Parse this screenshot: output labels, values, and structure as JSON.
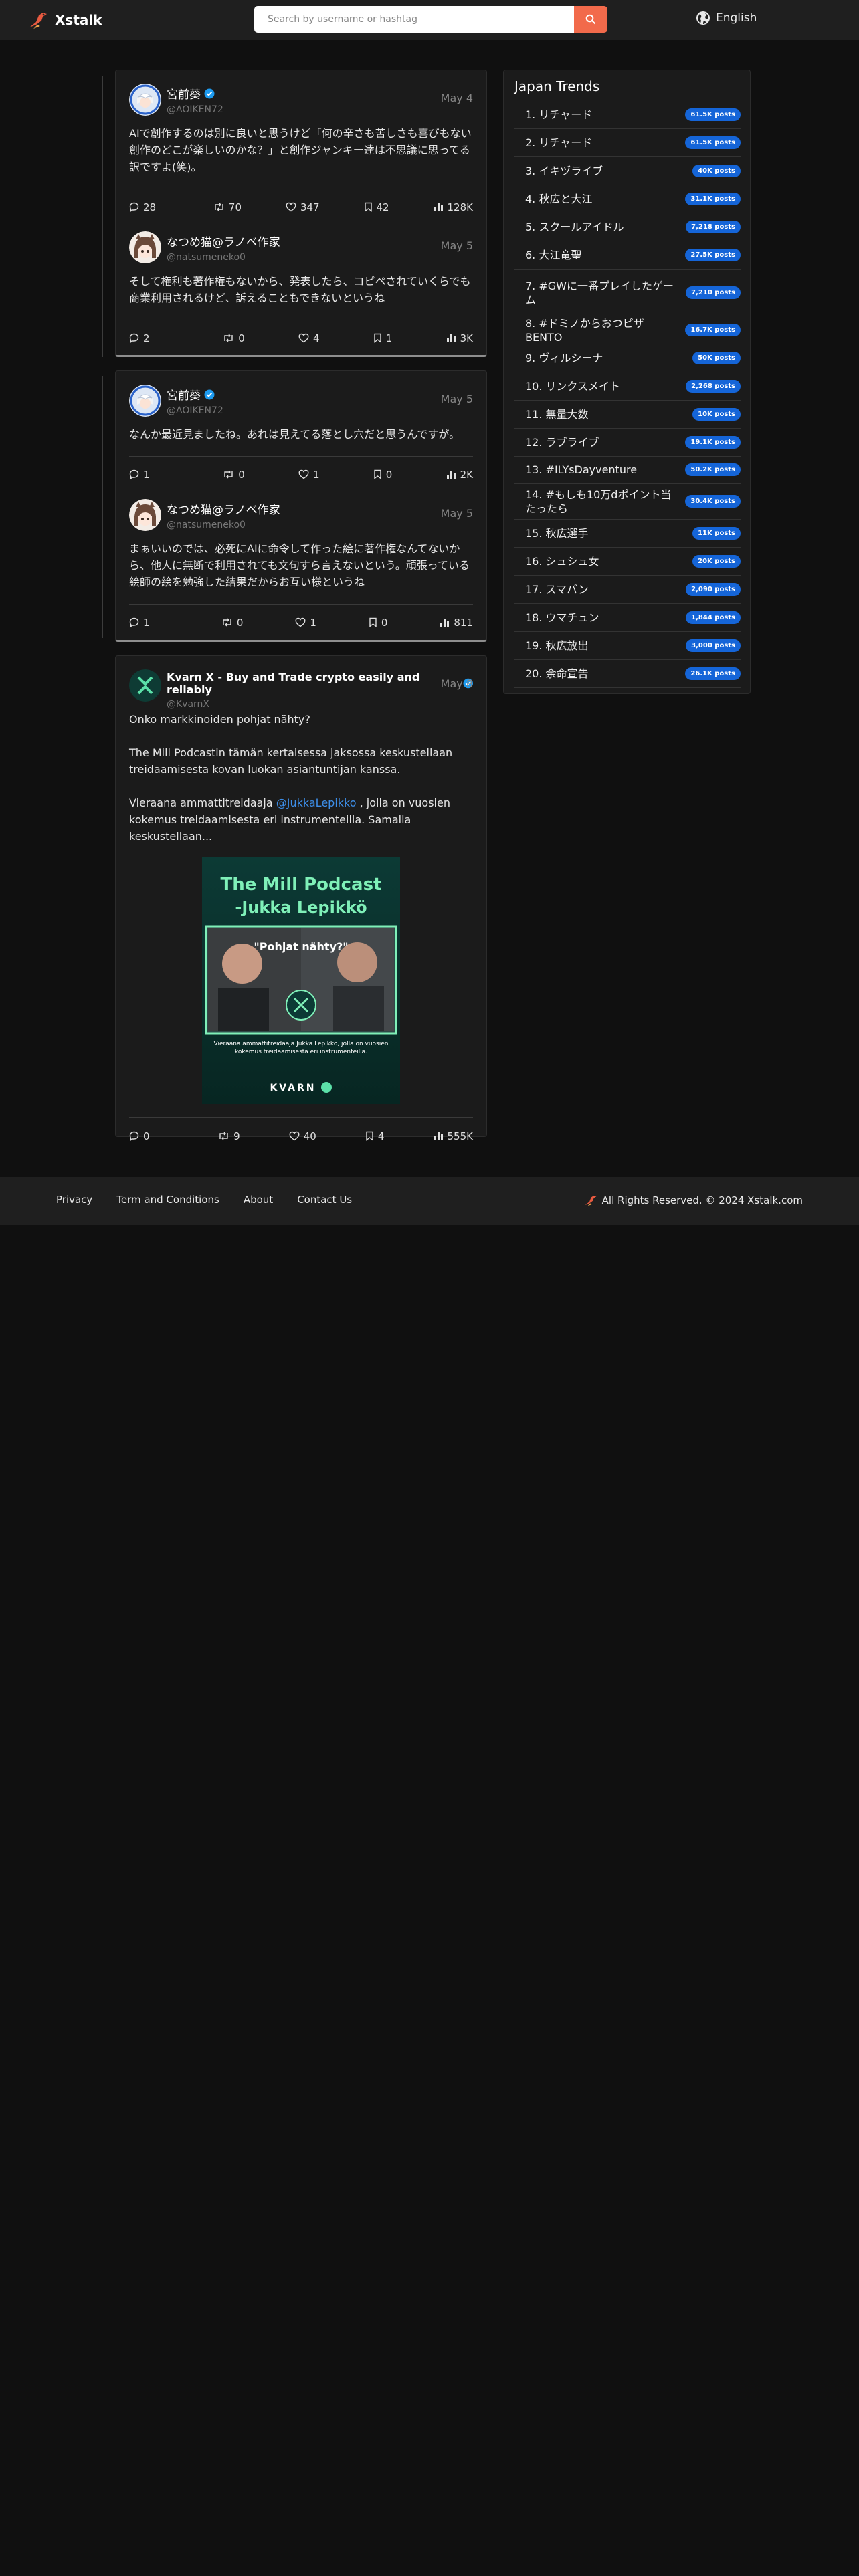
{
  "header": {
    "brand": "Xstalk",
    "search_placeholder": "Search by username or hashtag",
    "language": "English"
  },
  "threads": [
    {
      "posts": [
        {
          "name": "宮前葵",
          "verified": true,
          "handle": "@AOIKEN72",
          "date": "May 4",
          "text": "AIで創作するのは別に良いと思うけど「何の辛さも苦しさも喜びもない創作のどこが楽しいのかな？」と創作ジャンキー達は不思議に思ってる訳ですよ(笑)。",
          "stats": {
            "replies": "28",
            "reposts": "70",
            "likes": "347",
            "bookmarks": "42",
            "views": "128K"
          }
        },
        {
          "name": "なつめ猫@ラノベ作家",
          "verified": false,
          "handle": "@natsumeneko0",
          "date": "May 5",
          "text": "そして権利も著作権もないから、発表したら、コピペされていくらでも商業利用されるけど、訴えることもできないというね",
          "stats": {
            "replies": "2",
            "reposts": "0",
            "likes": "4",
            "bookmarks": "1",
            "views": "3K"
          }
        }
      ]
    },
    {
      "posts": [
        {
          "name": "宮前葵",
          "verified": true,
          "handle": "@AOIKEN72",
          "date": "May 5",
          "text": "なんか最近見ましたね。あれは見えてる落とし穴だと思うんですが。",
          "stats": {
            "replies": "1",
            "reposts": "0",
            "likes": "1",
            "bookmarks": "0",
            "views": "2K"
          }
        },
        {
          "name": "なつめ猫@ラノベ作家",
          "verified": false,
          "handle": "@natsumeneko0",
          "date": "May 5",
          "text": "まぁいいのでは、必死にAIに命令して作った絵に著作権なんてないから、他人に無断で利用されても文句すら言えないという。頑張っている絵師の絵を勉強した結果だからお互い様というね",
          "stats": {
            "replies": "1",
            "reposts": "0",
            "likes": "1",
            "bookmarks": "0",
            "views": "811"
          }
        }
      ]
    },
    {
      "posts": [
        {
          "name": "Kvarn X - Buy and Trade crypto easily and reliably",
          "verified": true,
          "handle": "@KvarnX",
          "date": "May 8",
          "text_lines": [
            "Onko markkinoiden pohjat nähty?",
            "The Mill Podcastin tämän kertaisessa jaksossa keskustellaan treidaamisesta kovan luokan asiantuntijan kanssa.",
            "Vieraana ammattitreidaaja ",
            "@JukkaLepikko",
            " , jolla on vuosien kokemus treidaamisesta eri instrumenteilla. Samalla keskustellaan..."
          ],
          "image": {
            "title": "The Mill Podcast",
            "subtitle": "-Jukka Lepikkö",
            "quote": "\"Pohjat nähty?\"",
            "caption": "Vieraana ammattitreidaaja Jukka Lepikkö, jolla on vuosien kokemus treidaamisesta eri instrumenteilla.",
            "brand": "KVARN"
          },
          "stats": {
            "replies": "0",
            "reposts": "9",
            "likes": "40",
            "bookmarks": "4",
            "views": "555K"
          }
        }
      ]
    }
  ],
  "trends": {
    "title": "Japan Trends",
    "items": [
      {
        "name": "1. リチャード",
        "count": "61.5K posts"
      },
      {
        "name": "2. リチャード",
        "count": "61.5K posts"
      },
      {
        "name": "3. イキヅライブ",
        "count": "40K posts"
      },
      {
        "name": "4. 秋広と大江",
        "count": "31.1K posts"
      },
      {
        "name": "5. スクールアイドル",
        "count": "7,218 posts"
      },
      {
        "name": "6. 大江竜聖",
        "count": "27.5K posts"
      },
      {
        "name": "7. #GWに一番プレイしたゲーム",
        "count": "7,210 posts"
      },
      {
        "name": "8. #ドミノからおつピザBENTO",
        "count": "16.7K posts"
      },
      {
        "name": "9. ヴィルシーナ",
        "count": "50K posts"
      },
      {
        "name": "10. リンクスメイト",
        "count": "2,268 posts"
      },
      {
        "name": "11. 無量大数",
        "count": "10K posts"
      },
      {
        "name": "12. ラブライブ",
        "count": "19.1K posts"
      },
      {
        "name": "13. #ILYsDayventure",
        "count": "50.2K posts"
      },
      {
        "name": "14. #もしも10万dポイント当たったら",
        "count": "30.4K posts"
      },
      {
        "name": "15. 秋広選手",
        "count": "11K posts"
      },
      {
        "name": "16. シュシュ女",
        "count": "20K posts"
      },
      {
        "name": "17. スマバン",
        "count": "2,090 posts"
      },
      {
        "name": "18. ウマチュン",
        "count": "1,844 posts"
      },
      {
        "name": "19. 秋広放出",
        "count": "3,000 posts"
      },
      {
        "name": "20. 余命宣告",
        "count": "26.1K posts"
      }
    ]
  },
  "footer": {
    "links": [
      "Privacy",
      "Term and Conditions",
      "About",
      "Contact Us"
    ],
    "copyright": "All Rights Reserved. © 2024 Xstalk.com"
  },
  "colors": {
    "accent": "#f26a4b",
    "badge": "#1565d8",
    "verified": "#1d9bf0",
    "link": "#3d8ee8"
  }
}
